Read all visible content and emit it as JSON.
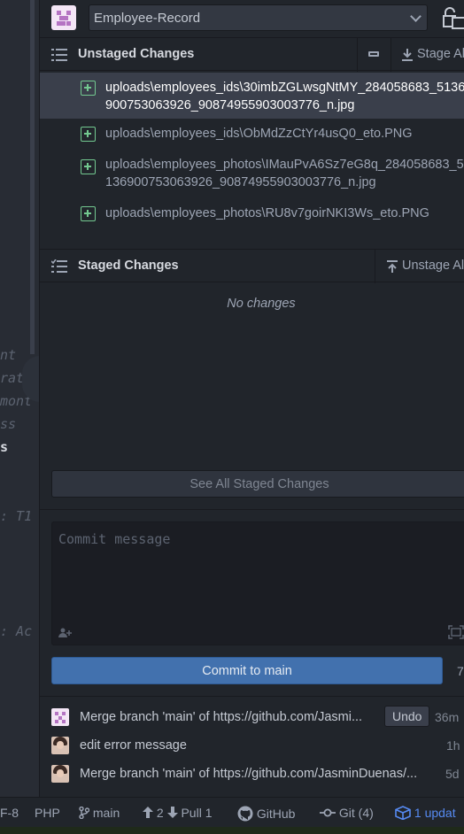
{
  "editor_fragments": [
    "nt",
    "rat",
    "mont",
    "ss",
    "s",
    ": T1",
    ": Ac"
  ],
  "repo": {
    "name": "Employee-Record"
  },
  "unstaged": {
    "title": "Unstaged Changes",
    "stage_all_label": "Stage All",
    "files": [
      {
        "line1": "uploads\\employees_ids\\30imbZGLwsgNtMY_284058683_5136",
        "line2": "900753063926_9087495590300377​6_n.jpg"
      },
      {
        "line1": "uploads\\employees_ids\\ObMdZzCtYr4usQ0_eto.PNG",
        "line2": ""
      },
      {
        "line1": "uploads\\employees_photos\\IMauPvA6Sz7eG8q_284058683_5",
        "line2": "136900753063926_90874955903003776_n.jpg"
      },
      {
        "line1": "uploads\\employees_photos\\RU8v7goirNKI3Ws_eto.PNG",
        "line2": ""
      }
    ]
  },
  "staged": {
    "title": "Staged Changes",
    "unstage_all_label": "Unstage All",
    "empty_text": "No changes"
  },
  "see_all_label": "See All Staged Changes",
  "commit": {
    "placeholder": "Commit message",
    "button_label": "Commit to main",
    "count": "7"
  },
  "recent_commits": [
    {
      "message": "Merge branch 'main' of https://github.com/Jasmi...",
      "undo_label": "Undo",
      "time": "36m",
      "avatar": "identicon"
    },
    {
      "message": "edit error message",
      "time": "1h",
      "avatar": "photo"
    },
    {
      "message": "Merge branch 'main' of https://github.com/JasminDuenas/...",
      "time": "5d",
      "avatar": "photo"
    }
  ],
  "status_bar": {
    "encoding": "F-8",
    "grammar": "PHP",
    "branch": "main",
    "push_count": "2",
    "pull_label": "Pull 1",
    "github_label": "GitHub",
    "git_label": "Git (4)",
    "updates_label": "1 updat"
  }
}
